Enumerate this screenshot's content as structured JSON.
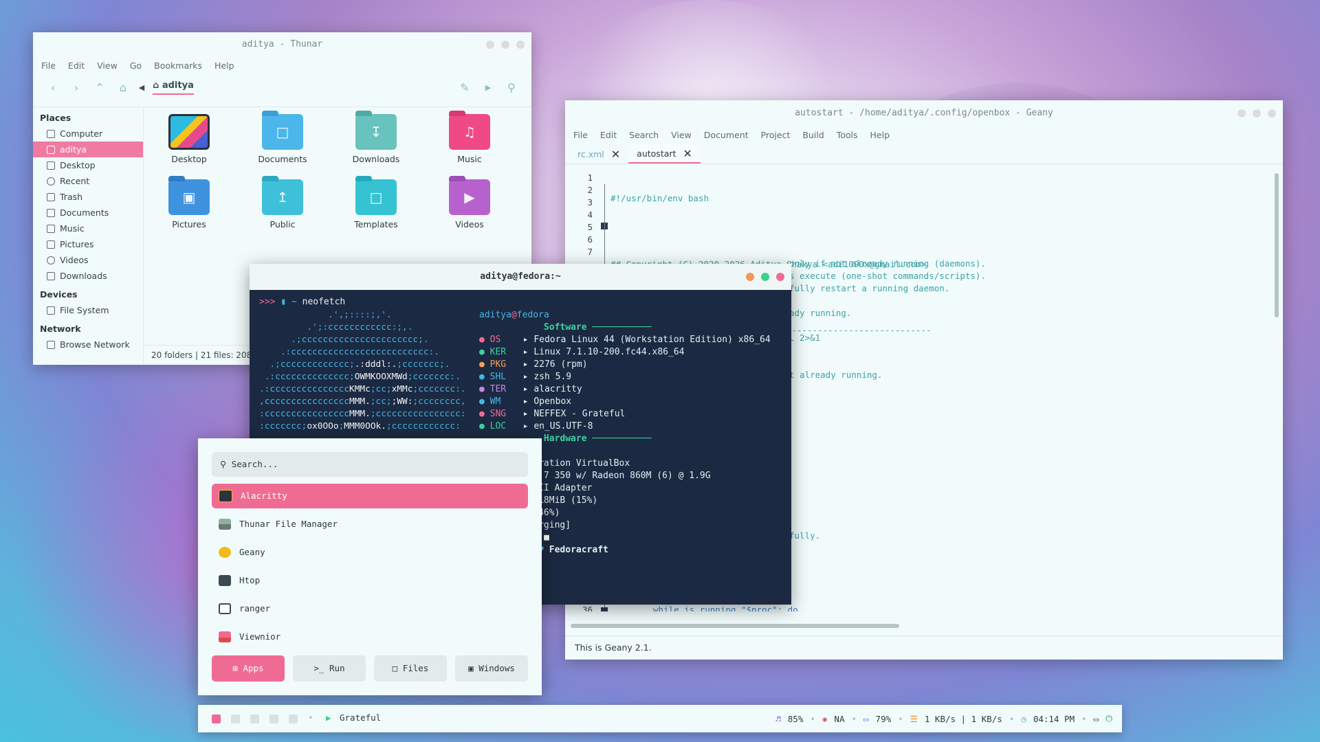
{
  "thunar": {
    "title": "aditya - Thunar",
    "menu": [
      "File",
      "Edit",
      "View",
      "Go",
      "Bookmarks",
      "Help"
    ],
    "path": "aditya",
    "sidebar": {
      "places_header": "Places",
      "places": [
        "Computer",
        "aditya",
        "Desktop",
        "Recent",
        "Trash",
        "Documents",
        "Music",
        "Pictures",
        "Videos",
        "Downloads"
      ],
      "devices_header": "Devices",
      "devices": [
        "File System"
      ],
      "network_header": "Network",
      "network": [
        "Browse Network"
      ]
    },
    "folders": [
      "Desktop",
      "Documents",
      "Downloads",
      "Music",
      "Pictures",
      "Public",
      "Templates",
      "Videos"
    ],
    "status": "20 folders  |  21 files: 208"
  },
  "geany": {
    "title": "autostart - /home/aditya/.config/openbox - Geany",
    "menu": [
      "File",
      "Edit",
      "Search",
      "View",
      "Document",
      "Project",
      "Build",
      "Tools",
      "Help"
    ],
    "tabs": [
      "rc.xml",
      "autostart"
    ],
    "line_numbers": [
      "1",
      "2",
      "3",
      "4",
      "5",
      "6",
      "7"
    ],
    "code": [
      "#!/usr/bin/env bash",
      "",
      "## Copyright (C) 2020-2026 Aditya Shakya <adi1090x@gmail.com>",
      "",
      "# Helper Functions -------------------------------------------",
      "# Usage:",
      "#"
    ],
    "code_behind": [
      "only if not already running (daemons).",
      "s execute (one-shot commands/scripts).",
      "fully restart a running daemon.",
      "ady running.",
      "L 2>&1",
      "t already running.",
      "fully."
    ],
    "line36_num": "36",
    "line36": "while is_running \"$proc\"; do",
    "status": "This is Geany 2.1."
  },
  "terminal": {
    "title": "aditya@fedora:~",
    "prompt": ">>>",
    "dir": "~",
    "command": "neofetch",
    "user": "aditya",
    "at": "@",
    "host": "fedora",
    "software_header": "Software",
    "hardware_header": "Hardware",
    "info": [
      {
        "key": "OS",
        "value": "Fedora Linux 44 (Workstation Edition) x86_64",
        "color": "#f06b93"
      },
      {
        "key": "KER",
        "value": "Linux 7.1.10-200.fc44.x86_64",
        "color": "#3fd1a0"
      },
      {
        "key": "PKG",
        "value": "2276 (rpm)",
        "color": "#f3a15a"
      },
      {
        "key": "SHL",
        "value": "zsh 5.9",
        "color": "#44b6e4"
      },
      {
        "key": "TER",
        "value": "alacritty",
        "color": "#c985e0"
      },
      {
        "key": "WM",
        "value": "Openbox",
        "color": "#44b6e4"
      },
      {
        "key": "SNG",
        "value": "NEFFEX - Grateful",
        "color": "#f06b93"
      },
      {
        "key": "LOC",
        "value": "en_US.UTF-8",
        "color": "#3fd1a0"
      }
    ],
    "hardware": [
      " mins",
      "racle Corporation VirtualBox",
      "MD Ryzen AI 7 350 w/ Radeon 860M (6) @ 1.9G",
      "Mware SVGA II Adapter",
      "174MiB / 7718MiB (15%)",
      ".6G / 23G (46%)",
      "9% [Not charging]"
    ],
    "footer_a": "I",
    "footer_b": "Fedoracraft",
    "ascii": [
      "             .',;::::;,'.",
      "         .';:cccccccccccc:;,.",
      "      .;cccccccccccccccccccccc;.",
      "    .:cccccccccccccccccccccccccc:.",
      "  .;ccccccccccccc;",
      " .:cccccccccccccc;",
      ".:ccccccccccccccc",
      ",cccccccccccccccc",
      ":cccccccccccccccc",
      ":ccccccc;"
    ]
  },
  "launcher": {
    "search_placeholder": "Search...",
    "apps": [
      "Alacritty",
      "Thunar File Manager",
      "Geany",
      "Htop",
      "ranger",
      "Viewnior"
    ],
    "buttons": [
      "Apps",
      "Run",
      "Files",
      "Windows"
    ]
  },
  "panel": {
    "song": "Grateful",
    "volume": "85%",
    "net_status": "NA",
    "battery": "79%",
    "traffic": "1 KB/s | 1 KB/s",
    "time": "04:14 PM"
  },
  "colors": {
    "accent": "#f06b93",
    "terminal_bg": "#1b2a42",
    "window_bg": "#f1fbfb"
  }
}
